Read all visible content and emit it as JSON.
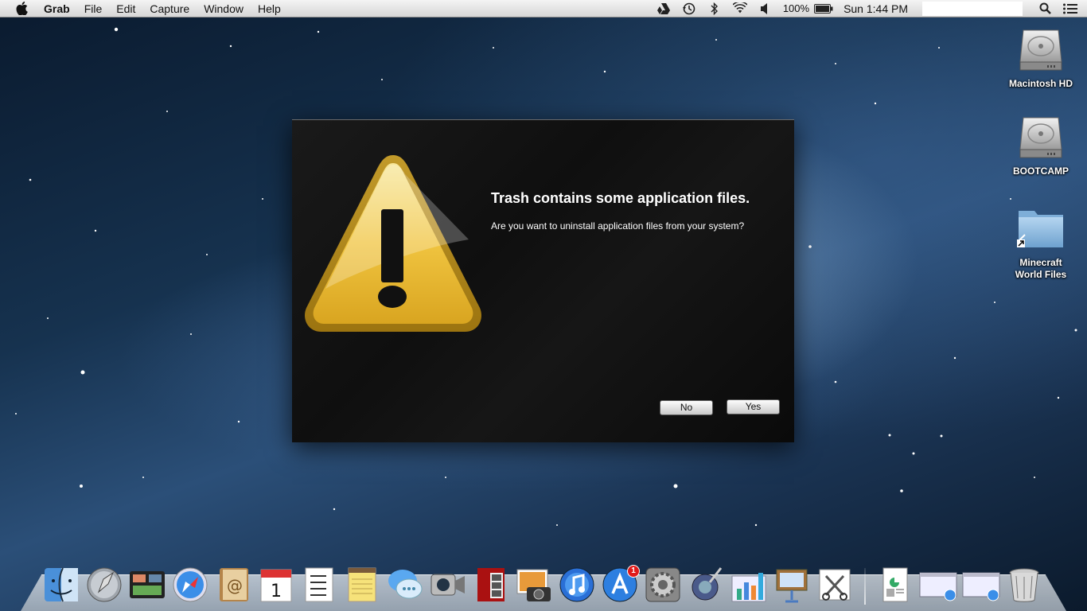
{
  "menubar": {
    "app_name": "Grab",
    "items": [
      "File",
      "Edit",
      "Capture",
      "Window",
      "Help"
    ],
    "battery": "100%",
    "clock": "Sun 1:44 PM"
  },
  "desktop": {
    "icons": [
      {
        "label": "Macintosh HD",
        "icon": "hard-drive-icon"
      },
      {
        "label": "BOOTCAMP",
        "icon": "hard-drive-icon"
      },
      {
        "label_line1": "Minecraft",
        "label_line2": "World Files",
        "icon": "folder-alias-icon"
      }
    ]
  },
  "dialog": {
    "title": "Trash contains some application files.",
    "message": "Are you want to uninstall application files from your system?",
    "no_label": "No",
    "yes_label": "Yes",
    "icon": "warning-icon"
  },
  "dock": {
    "app_store_badge": "1"
  },
  "colors": {
    "warning_yellow": "#e8b52a",
    "dialog_bg": "#111111",
    "badge_red": "#e01b1b"
  }
}
